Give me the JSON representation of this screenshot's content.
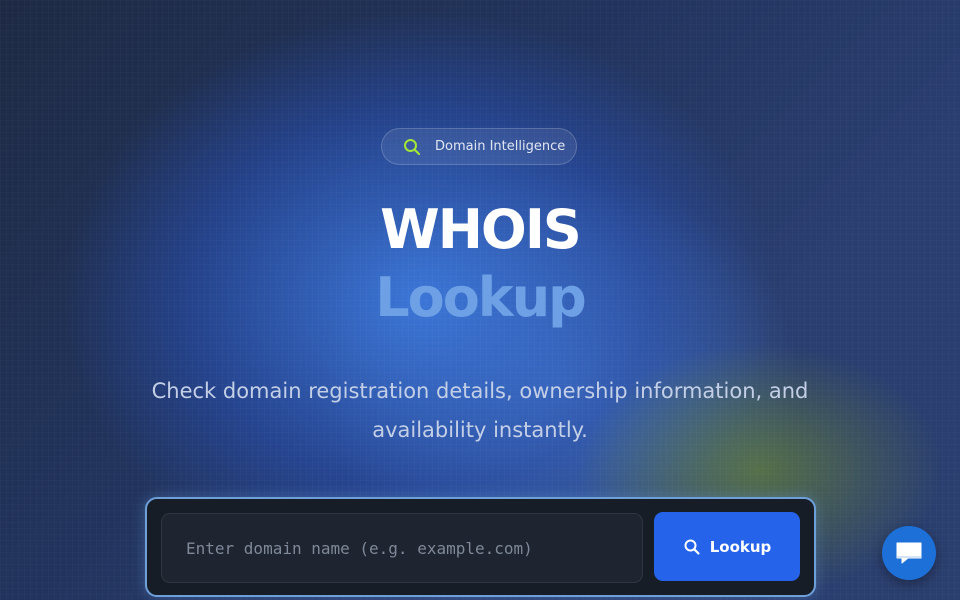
{
  "badge": {
    "icon": "search-icon",
    "label": "Domain Intelligence",
    "icon_color": "#a3e635"
  },
  "hero": {
    "title_line1": "WHOIS",
    "title_line2": "Lookup",
    "subtitle": "Check domain registration details, ownership information, and availability instantly."
  },
  "search": {
    "placeholder": "Enter domain name (e.g. example.com)",
    "value": "",
    "button_icon": "search-icon",
    "button_label": "Lookup"
  },
  "chat": {
    "icon": "chat-bubble-icon"
  },
  "colors": {
    "accent": "#2563eb",
    "title_secondary": "#6ea0e6",
    "badge_icon": "#a3e635",
    "chat_button": "#1d70d8"
  }
}
